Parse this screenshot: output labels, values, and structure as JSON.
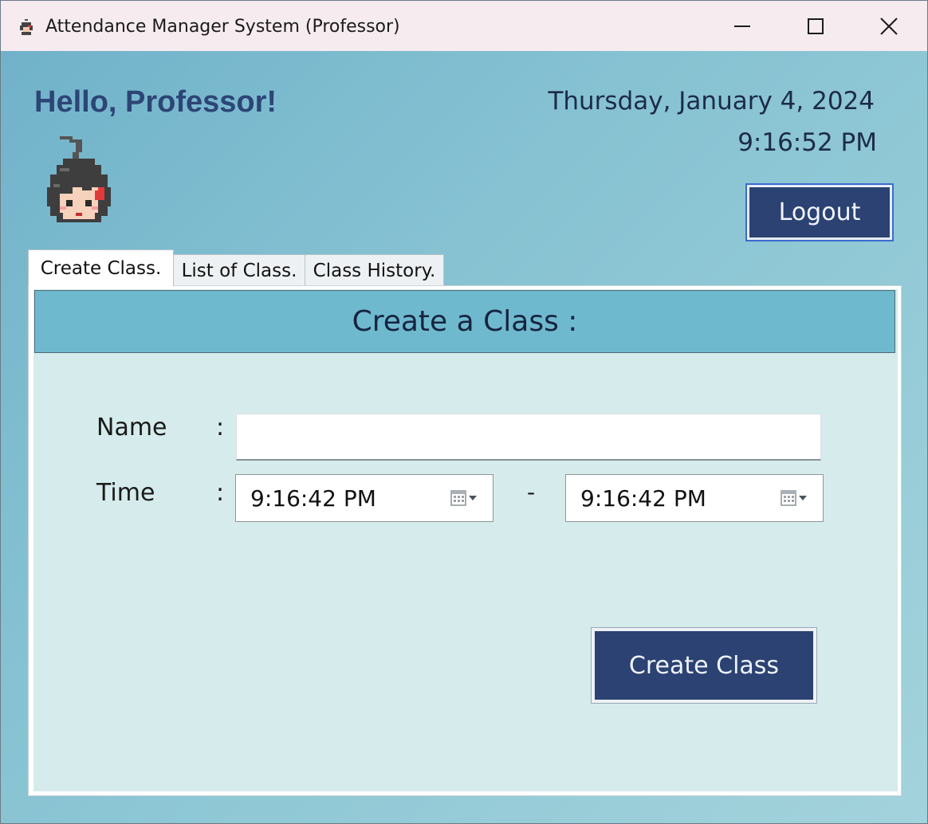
{
  "window": {
    "title": "Attendance Manager System (Professor)",
    "icons": {
      "app": "pixel-avatar-icon",
      "minimize": "minimize-icon",
      "maximize": "maximize-icon",
      "close": "close-icon"
    }
  },
  "header": {
    "greeting": "Hello, Professor!",
    "date": "Thursday, January 4, 2024",
    "time": "9:16:52 PM",
    "logout_label": "Logout",
    "avatar_icon": "pixel-avatar"
  },
  "tabs": [
    {
      "label": "Create Class.",
      "active": true
    },
    {
      "label": "List of Class.",
      "active": false
    },
    {
      "label": "Class History.",
      "active": false
    }
  ],
  "create_class": {
    "heading": "Create a Class :",
    "name_label": "Name",
    "time_label": "Time",
    "colon": ":",
    "name_value": "",
    "start_time": "9:16:42 PM",
    "time_separator": "-",
    "end_time": "9:16:42 PM",
    "picker_icon": "calendar-dropdown-icon",
    "submit_label": "Create Class"
  },
  "colors": {
    "primary_button": "#2b4272",
    "header_text": "#2d4576",
    "panel_bg": "#d6ecec",
    "panel_header_bg": "#6fb9cf",
    "titlebar_bg": "#f6ebee"
  }
}
